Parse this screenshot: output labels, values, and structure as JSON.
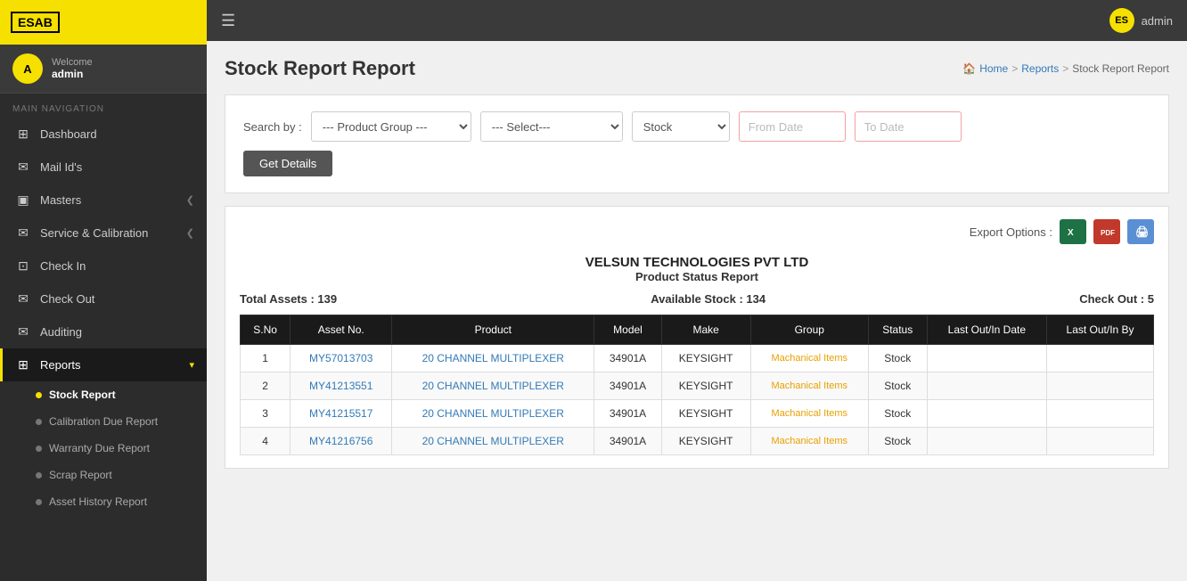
{
  "sidebar": {
    "logo_text": "ESAB",
    "user": {
      "welcome": "Welcome",
      "name": "admin",
      "avatar_initials": "A"
    },
    "section_label": "MAIN NAVIGATION",
    "items": [
      {
        "id": "dashboard",
        "label": "Dashboard",
        "icon": "⊞",
        "has_sub": false
      },
      {
        "id": "mailids",
        "label": "Mail Id's",
        "icon": "✉",
        "has_sub": false
      },
      {
        "id": "masters",
        "label": "Masters",
        "icon": "⊡",
        "has_sub": true
      },
      {
        "id": "service",
        "label": "Service & Calibration",
        "icon": "✉",
        "has_sub": true
      },
      {
        "id": "checkin",
        "label": "Check In",
        "icon": "⊡",
        "has_sub": false
      },
      {
        "id": "checkout",
        "label": "Check Out",
        "icon": "✉",
        "has_sub": false
      },
      {
        "id": "auditing",
        "label": "Auditing",
        "icon": "✉",
        "has_sub": false
      },
      {
        "id": "reports",
        "label": "Reports",
        "icon": "⊞",
        "has_sub": true,
        "active": true
      }
    ],
    "report_sub_items": [
      {
        "id": "stock-report",
        "label": "Stock Report",
        "active": true
      },
      {
        "id": "calibration-due",
        "label": "Calibration Due Report",
        "active": false
      },
      {
        "id": "warranty-due",
        "label": "Warranty Due Report",
        "active": false
      },
      {
        "id": "scrap-report",
        "label": "Scrap Report",
        "active": false
      },
      {
        "id": "asset-history",
        "label": "Asset History Report",
        "active": false
      }
    ]
  },
  "topbar": {
    "admin_label": "admin",
    "admin_initials": "ES"
  },
  "page": {
    "title": "Stock Report Report",
    "breadcrumb": {
      "home": "Home",
      "reports": "Reports",
      "current": "Stock Report Report"
    }
  },
  "search": {
    "label": "Search by :",
    "product_group_placeholder": "--- Product Group ---",
    "select_placeholder": "--- Select---",
    "stock_option": "Stock",
    "from_date_placeholder": "From Date",
    "to_date_placeholder": "To Date",
    "button_label": "Get Details"
  },
  "export": {
    "label": "Export Options  :"
  },
  "report": {
    "company_name": "VELSUN TECHNOLOGIES PVT LTD",
    "subtitle": "Product Status Report",
    "total_assets_label": "Total Assets  :  ",
    "total_assets_value": "139",
    "available_stock_label": "Available Stock  :  ",
    "available_stock_value": "134",
    "check_out_label": "Check Out  :  ",
    "check_out_value": "5"
  },
  "table": {
    "headers": [
      "S.No",
      "Asset No.",
      "Product",
      "Model",
      "Make",
      "Group",
      "Status",
      "Last Out/In Date",
      "Last Out/In By"
    ],
    "rows": [
      {
        "sno": "1",
        "asset_no": "MY57013703",
        "product": "20 CHANNEL MULTIPLEXER",
        "model": "34901A",
        "make": "KEYSIGHT",
        "group": "Machanical Items",
        "status": "Stock",
        "last_date": "",
        "last_by": ""
      },
      {
        "sno": "2",
        "asset_no": "MY41213551",
        "product": "20 CHANNEL MULTIPLEXER",
        "model": "34901A",
        "make": "KEYSIGHT",
        "group": "Machanical Items",
        "status": "Stock",
        "last_date": "",
        "last_by": ""
      },
      {
        "sno": "3",
        "asset_no": "MY41215517",
        "product": "20 CHANNEL MULTIPLEXER",
        "model": "34901A",
        "make": "KEYSIGHT",
        "group": "Machanical Items",
        "status": "Stock",
        "last_date": "",
        "last_by": ""
      },
      {
        "sno": "4",
        "asset_no": "MY41216756",
        "product": "20 CHANNEL MULTIPLEXER",
        "model": "34901A",
        "make": "KEYSIGHT",
        "group": "Machanical Items",
        "status": "Stock",
        "last_date": "",
        "last_by": ""
      }
    ]
  }
}
